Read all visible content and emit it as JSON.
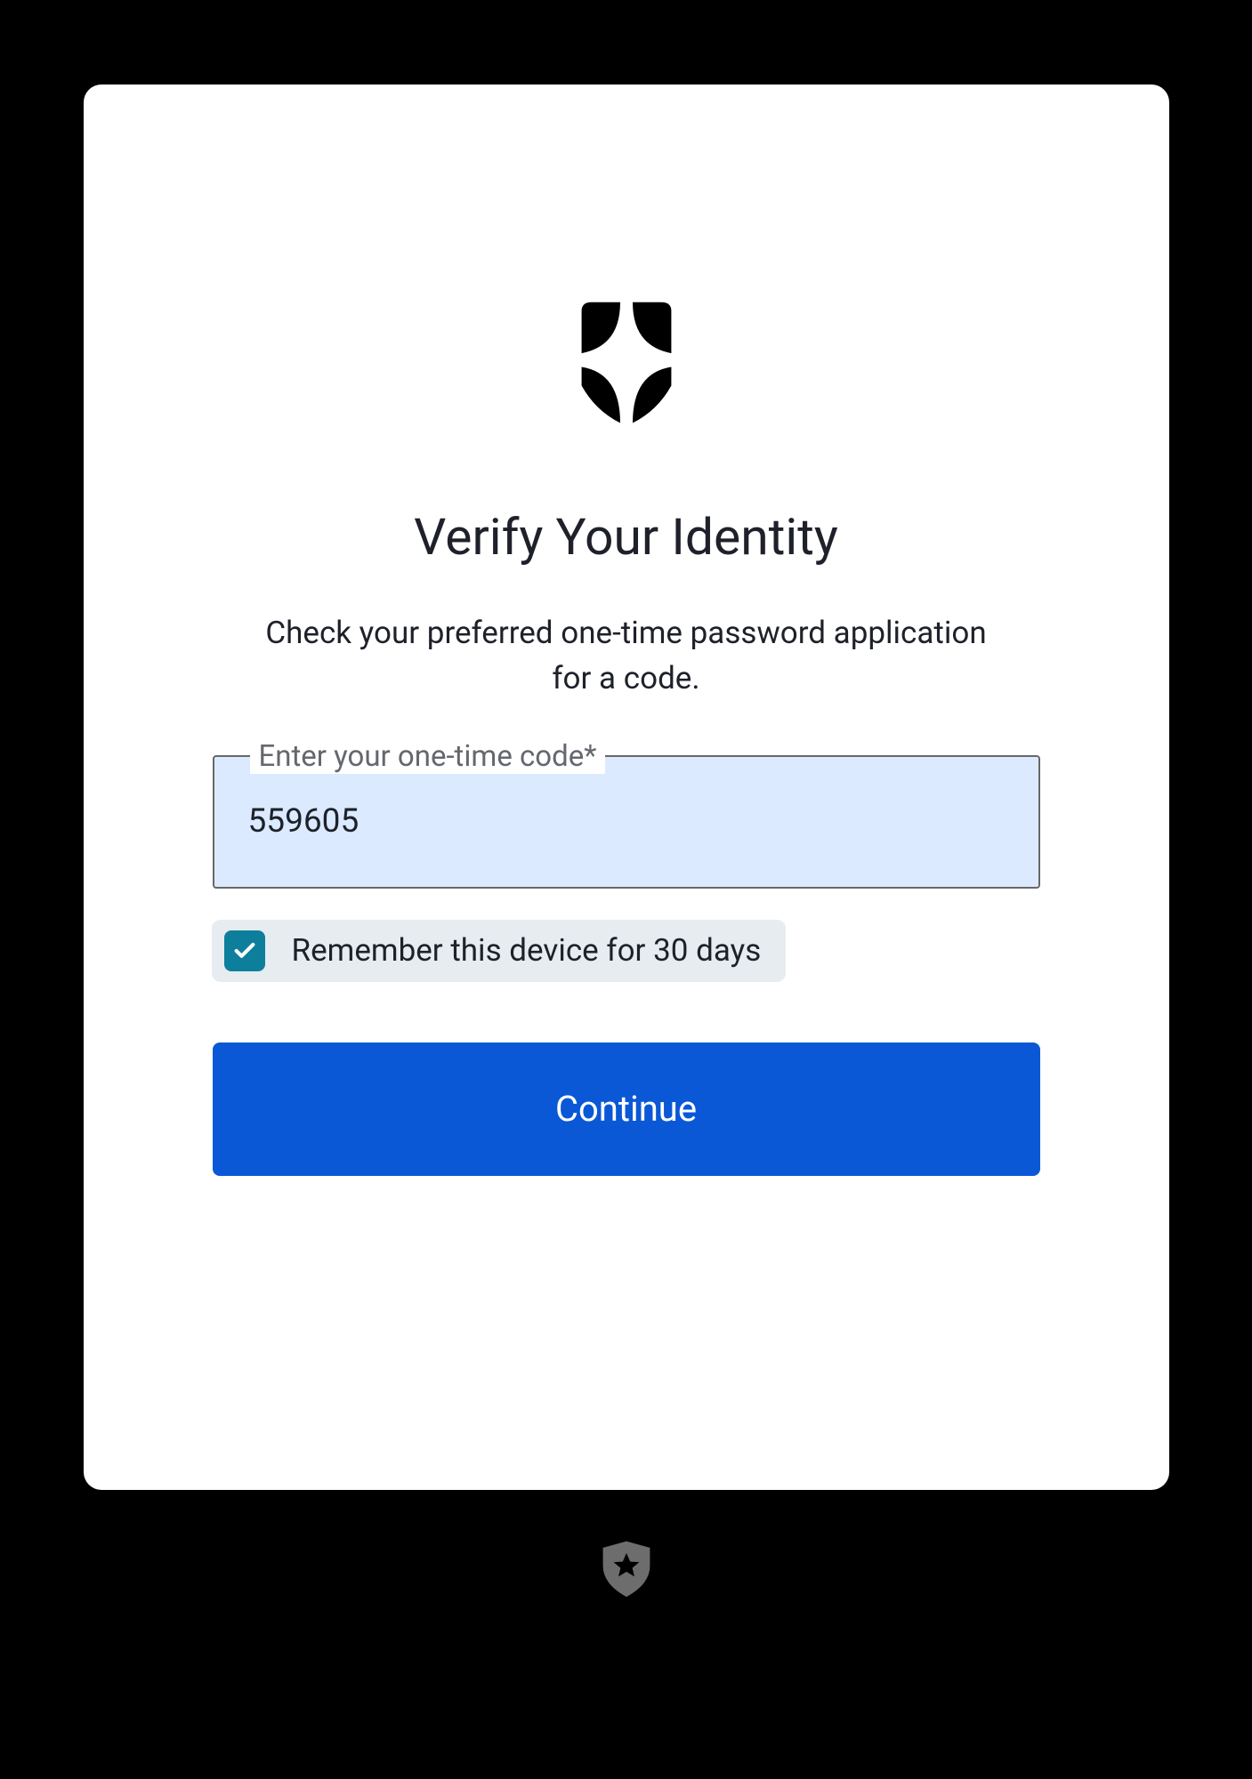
{
  "dialog": {
    "title": "Verify Your Identity",
    "subtitle": "Check your preferred one-time password application for a code.",
    "otp": {
      "label": "Enter your one-time code*",
      "value": "559605"
    },
    "remember": {
      "label": "Remember this device for 30 days",
      "checked": true
    },
    "continue_label": "Continue"
  }
}
